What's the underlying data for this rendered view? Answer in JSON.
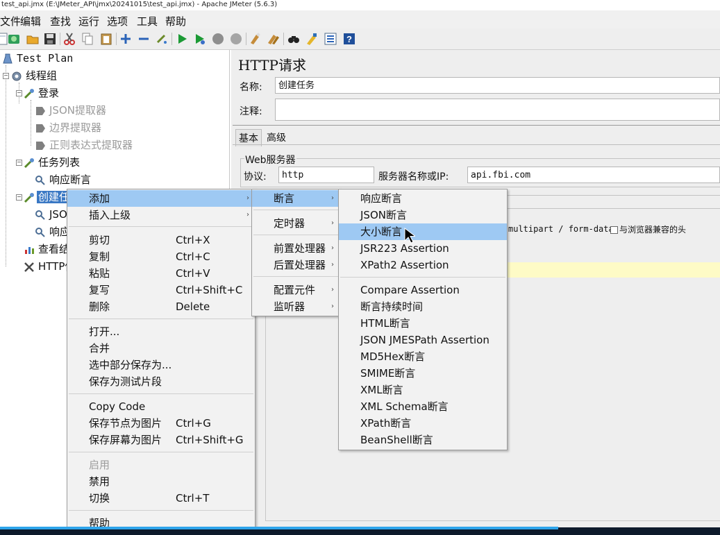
{
  "window": {
    "title": "test_api.jmx (E:\\JMeter_API\\jmx\\20241015\\test_api.jmx) - Apache JMeter (5.6.3)"
  },
  "menubar": [
    "文件",
    "编辑",
    "查找",
    "运行",
    "选项",
    "工具",
    "帮助"
  ],
  "toolbar_icons": [
    "new-icon",
    "templates-icon",
    "open-icon",
    "save-icon",
    "cut-icon",
    "copy-icon",
    "paste-icon",
    "expand-icon",
    "collapse-icon",
    "toggle-icon",
    "start-icon",
    "start-no-pause-icon",
    "stop-icon",
    "shutdown-icon",
    "clear-icon",
    "clear-all-icon",
    "search-icon",
    "reset-search-icon",
    "function-helper-icon",
    "help-icon"
  ],
  "tree": {
    "test_plan": "Test Plan",
    "thread_group": "线程组",
    "login": "登录",
    "json_extractor": "JSON提取器",
    "boundary_extractor": "边界提取器",
    "regex_extractor": "正则表达式提取器",
    "task_list": "任务列表",
    "response_assertion": "响应断言",
    "create_task": "创建任",
    "json_child": "JSO",
    "response_child": "响应",
    "view_results": "查看结",
    "http_defaults": "HTTP信"
  },
  "panel": {
    "title": "HTTP请求",
    "name_label": "名称:",
    "name_value": "创建任务",
    "comment_label": "注释:",
    "comment_value": "",
    "tab_basic": "基本",
    "tab_advanced": "高级",
    "web_server_legend": "Web服务器",
    "protocol_label": "协议:",
    "protocol_value": "http",
    "server_label": "服务器名称或IP:",
    "server_value": "api.fbi.com",
    "multipart_text": "multipart / form-data",
    "browser_headers_text": "与浏览器兼容的头"
  },
  "context_menu": {
    "items": [
      {
        "label": "添加",
        "shortcut": "",
        "submenu": true,
        "highlighted": true
      },
      {
        "label": "插入上级",
        "shortcut": "",
        "submenu": true
      },
      {
        "label": "剪切",
        "shortcut": "Ctrl+X"
      },
      {
        "label": "复制",
        "shortcut": "Ctrl+C"
      },
      {
        "label": "粘贴",
        "shortcut": "Ctrl+V"
      },
      {
        "label": "复写",
        "shortcut": "Ctrl+Shift+C"
      },
      {
        "label": "删除",
        "shortcut": "Delete"
      },
      {
        "label": "打开...",
        "shortcut": ""
      },
      {
        "label": "合并",
        "shortcut": ""
      },
      {
        "label": "选中部分保存为...",
        "shortcut": ""
      },
      {
        "label": "保存为测试片段",
        "shortcut": ""
      },
      {
        "label": "Copy Code",
        "shortcut": ""
      },
      {
        "label": "保存节点为图片",
        "shortcut": "Ctrl+G"
      },
      {
        "label": "保存屏幕为图片",
        "shortcut": "Ctrl+Shift+G"
      },
      {
        "label": "启用",
        "shortcut": "",
        "disabled": true
      },
      {
        "label": "禁用",
        "shortcut": ""
      },
      {
        "label": "切换",
        "shortcut": "Ctrl+T"
      },
      {
        "label": "帮助",
        "shortcut": ""
      }
    ]
  },
  "add_submenu": {
    "items": [
      {
        "label": "断言",
        "submenu": true,
        "highlighted": true
      },
      {
        "label": "定时器",
        "submenu": true
      },
      {
        "label": "前置处理器",
        "submenu": true
      },
      {
        "label": "后置处理器",
        "submenu": true
      },
      {
        "label": "配置元件",
        "submenu": true
      },
      {
        "label": "监听器",
        "submenu": true
      }
    ]
  },
  "assertion_submenu": {
    "items": [
      {
        "label": "响应断言"
      },
      {
        "label": "JSON断言"
      },
      {
        "label": "大小断言",
        "highlighted": true
      },
      {
        "label": "JSR223 Assertion"
      },
      {
        "label": "XPath2 Assertion"
      },
      {
        "label": "Compare Assertion"
      },
      {
        "label": "断言持续时间"
      },
      {
        "label": "HTML断言"
      },
      {
        "label": "JSON JMESPath Assertion"
      },
      {
        "label": "MD5Hex断言"
      },
      {
        "label": "SMIME断言"
      },
      {
        "label": "XML断言"
      },
      {
        "label": "XML Schema断言"
      },
      {
        "label": "XPath断言"
      },
      {
        "label": "BeanShell断言"
      }
    ]
  },
  "colors": {
    "highlight": "#9ec9f3",
    "tree_selection": "#3a78c4",
    "menu_bg": "#f2f2f2",
    "notice_bar": "#fefbc6"
  }
}
